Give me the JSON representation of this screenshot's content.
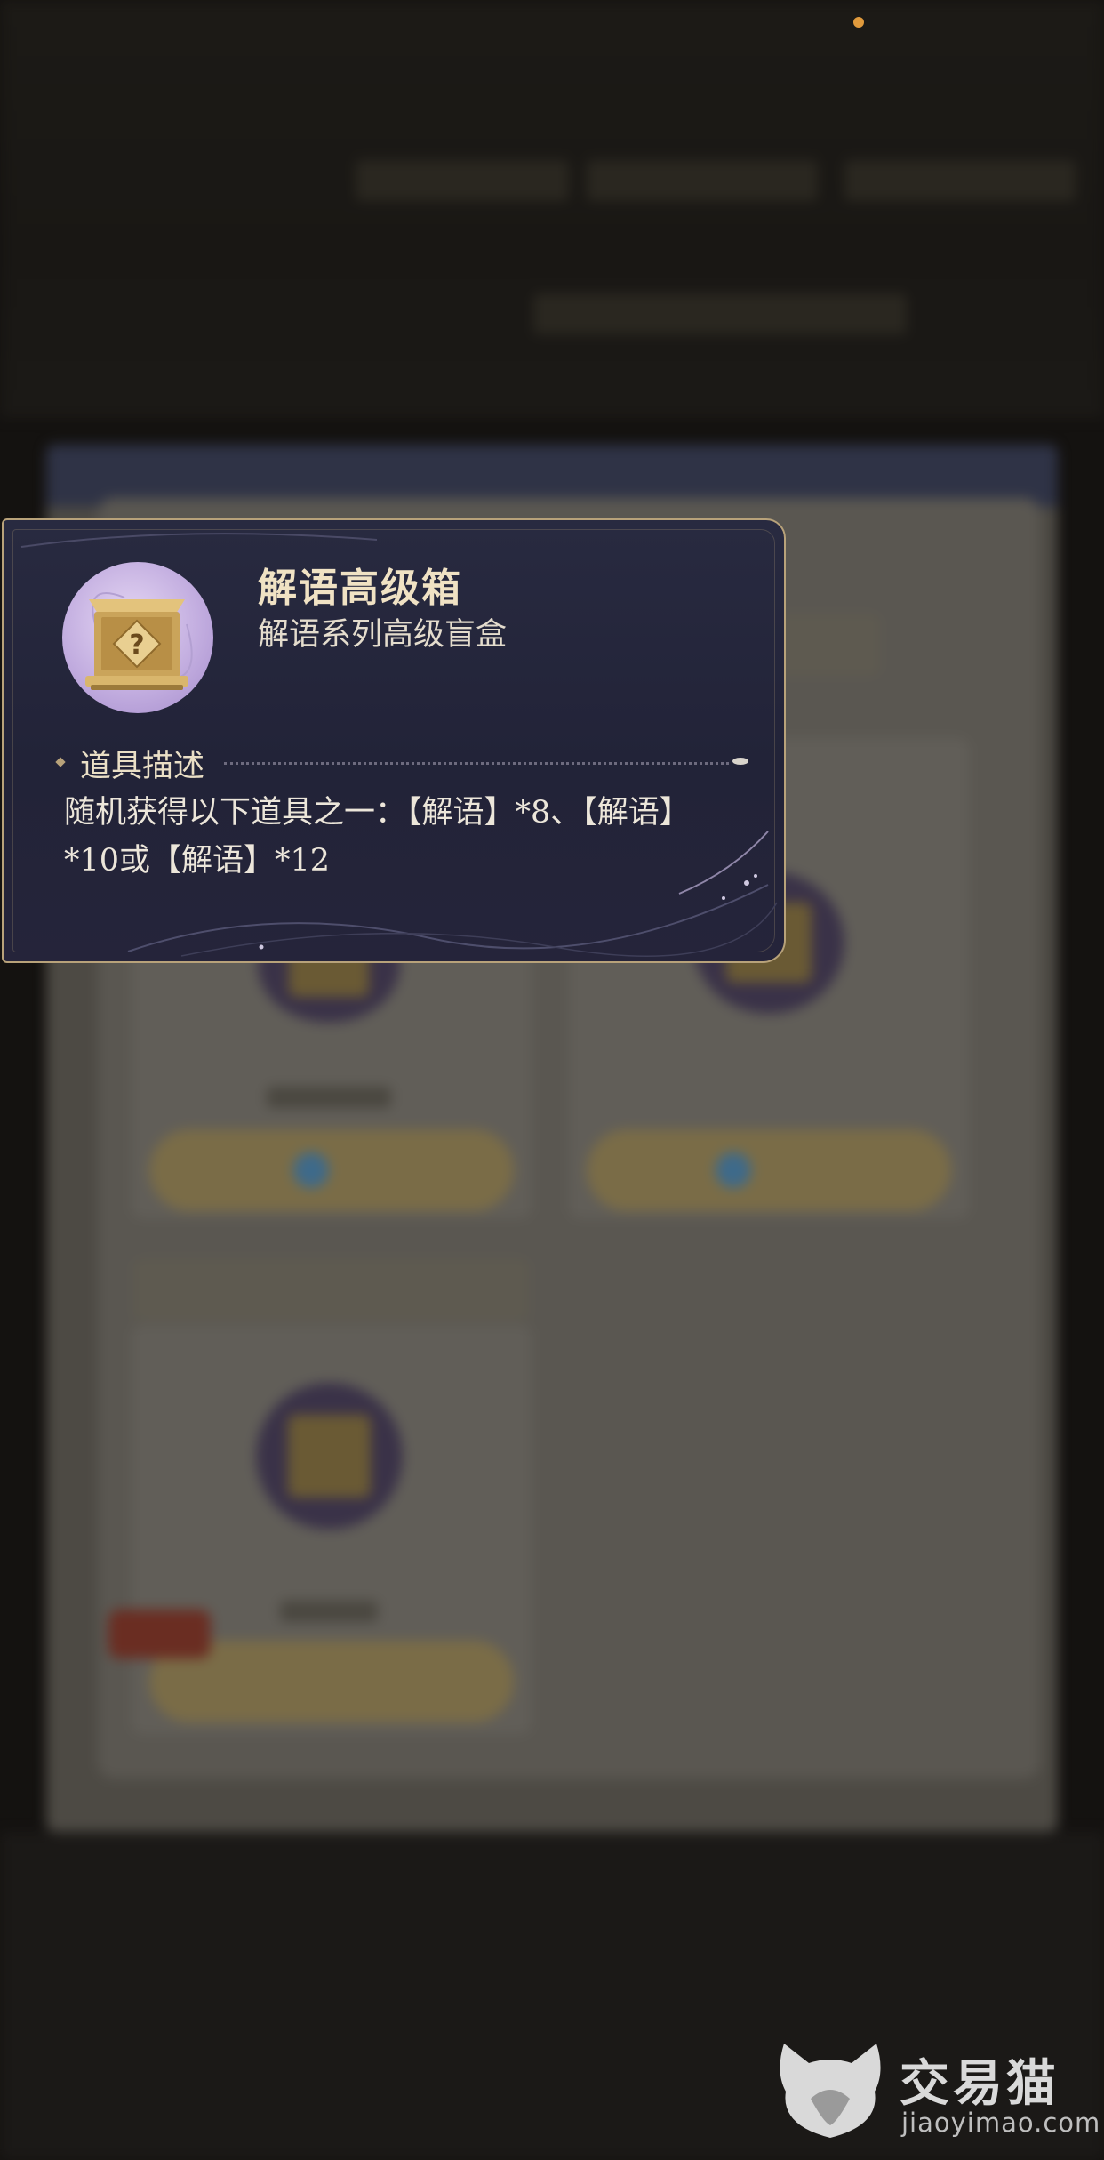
{
  "tooltip": {
    "item_name": "解语高级箱",
    "item_subtitle": "解语系列高级盲盒",
    "section_title": "道具描述",
    "description": "随机获得以下道具之一：【解语】*8、【解语】*10或【解语】*12",
    "icon": "golden-mystery-box-icon"
  },
  "watermark": {
    "brand_cn": "交易猫",
    "brand_en": "jiaoyimao.com",
    "logo": "cat-logo-icon"
  },
  "colors": {
    "tooltip_bg": "#25243a",
    "tooltip_border": "#b8a27a",
    "title_gold": "#f0e2c4",
    "notification_dot": "#e09a3c"
  }
}
